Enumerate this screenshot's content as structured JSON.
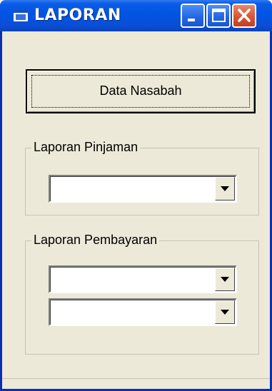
{
  "window": {
    "title": "LAPORAN",
    "icon": "app-window-icon",
    "controls": [
      "minimize-icon",
      "maximize-icon",
      "close-icon"
    ]
  },
  "buttons": {
    "data_nasabah": "Data Nasabah"
  },
  "groups": {
    "pinjaman": {
      "label": "Laporan Pinjaman",
      "combos": [
        {
          "value": ""
        }
      ]
    },
    "pembayaran": {
      "label": "Laporan Pembayaran",
      "combos": [
        {
          "value": ""
        },
        {
          "value": ""
        }
      ]
    }
  },
  "colors": {
    "titlebar": "#0054e3",
    "window_bg": "#ece9d8",
    "close_button": "#d85533"
  }
}
